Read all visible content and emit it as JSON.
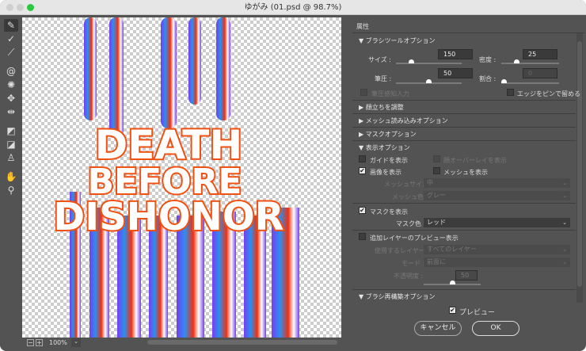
{
  "window": {
    "title": "ゆがみ (01.psd @ 98.7%)",
    "traffic_colors": [
      "#cfcfcf",
      "#cfcfcf",
      "#2ac840"
    ]
  },
  "toolbar": [
    "forward-warp",
    "reconstruct",
    "smooth",
    "twirl",
    "pucker",
    "bloat",
    "push-left",
    "freeze-mask",
    "thaw-mask",
    "face",
    "hand",
    "zoom"
  ],
  "canvas": {
    "lines": [
      "DEATH",
      "BEFORE",
      "DISHONOR"
    ]
  },
  "status": {
    "zoom": "100%"
  },
  "panel": {
    "title": "属性",
    "brush_options": {
      "title": "ブラシツールオプション",
      "size_label": "サイズ :",
      "size": "150",
      "size_pct": 0.35,
      "density_label": "密度 :",
      "density": "25",
      "density_pct": 0.25,
      "pressure_label": "筆圧 :",
      "pressure": "50",
      "pressure_pct": 0.5,
      "rate_label": "割合 :",
      "rate": "0",
      "rate_pct": 0,
      "stylus": "筆圧感知入力",
      "pin_edges": "エッジをピンで留める"
    },
    "face_aware": "顔立ちを調整",
    "load_mesh": "メッシュ読み込みオプション",
    "mask_options": "マスクオプション",
    "view_options": {
      "title": "表示オプション",
      "show_guides": "ガイドを表示",
      "show_face_overlay": "顔オーバーレイを表示",
      "show_image": "画像を表示",
      "show_mesh": "メッシュを表示",
      "mesh_size_label": "メッシュサイズ :",
      "mesh_size": "中",
      "mesh_color_label": "メッシュ色 :",
      "mesh_color": "グレー"
    },
    "show_mask": "マスクを表示",
    "mask_color_label": "マスク色 :",
    "mask_color": "レッド",
    "show_backdrop": "追加レイヤーのプレビュー表示",
    "use_label": "使用するレイヤー :",
    "use": "すべてのレイヤー",
    "mode_label": "モード :",
    "mode": "前面に",
    "opacity_label": "不透明度 :",
    "opacity": "50",
    "opacity_pct": 0.5,
    "brush_reconstruct": "ブラシ再構築オプション"
  },
  "footer": {
    "preview": "プレビュー",
    "cancel": "キャンセル",
    "ok": "OK"
  }
}
